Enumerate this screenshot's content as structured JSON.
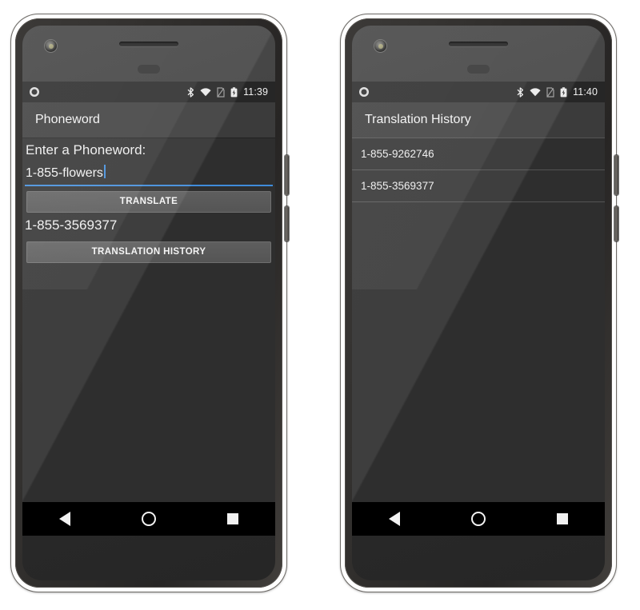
{
  "phones": [
    {
      "id": "phoneword-app",
      "status_bar": {
        "left_icon": "record-circle-icon",
        "icons": [
          "bluetooth-icon",
          "wifi-icon",
          "no-sim-icon",
          "battery-charging-icon"
        ],
        "clock": "11:39"
      },
      "appbar": {
        "title": "Phoneword"
      },
      "screen": {
        "label": "Enter a Phoneword:",
        "input_value": "1-855-flowers",
        "input_placeholder": "Enter a Phoneword",
        "translate_button": "TRANSLATE",
        "result": "1-855-3569377",
        "history_button": "TRANSLATION HISTORY"
      },
      "navbar": {
        "back": "back-button",
        "home": "home-button",
        "recents": "recents-button"
      }
    },
    {
      "id": "translation-history-app",
      "status_bar": {
        "left_icon": "record-circle-icon",
        "icons": [
          "bluetooth-icon",
          "wifi-icon",
          "no-sim-icon",
          "battery-charging-icon"
        ],
        "clock": "11:40"
      },
      "appbar": {
        "title": "Translation History"
      },
      "screen": {
        "list": [
          "1-855-9262746",
          "1-855-3569377"
        ]
      },
      "navbar": {
        "back": "back-button",
        "home": "home-button",
        "recents": "recents-button"
      }
    }
  ],
  "colors": {
    "screen_background": "#2e2e2e",
    "appbar_background": "#3b3b3b",
    "statusbar_background": "#262626",
    "accent_underline": "#3f8cdb",
    "button_face": "#5a5a5a",
    "navbar_background": "#000000",
    "text_primary": "#f2f2f2"
  }
}
